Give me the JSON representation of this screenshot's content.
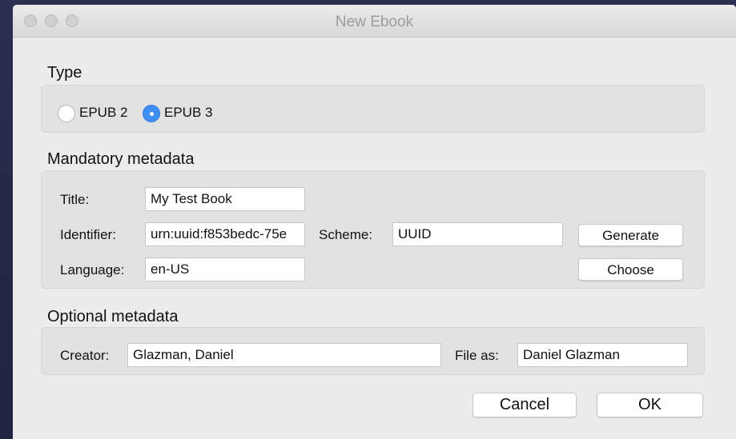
{
  "window": {
    "title": "New Ebook"
  },
  "type_section": {
    "title": "Type",
    "options": [
      {
        "label": "EPUB 2",
        "selected": false
      },
      {
        "label": "EPUB 3",
        "selected": true
      }
    ]
  },
  "mandatory": {
    "title": "Mandatory metadata",
    "title_label": "Title:",
    "title_value": "My Test Book",
    "identifier_label": "Identifier:",
    "identifier_value": "urn:uuid:f853bedc-75e",
    "scheme_label": "Scheme:",
    "scheme_value": "UUID",
    "generate_label": "Generate",
    "language_label": "Language:",
    "language_value": "en-US",
    "choose_label": "Choose"
  },
  "optional": {
    "title": "Optional metadata",
    "creator_label": "Creator:",
    "creator_value": "Glazman, Daniel",
    "file_as_label": "File as:",
    "file_as_value": "Daniel Glazman"
  },
  "buttons": {
    "cancel": "Cancel",
    "ok": "OK"
  },
  "colors": {
    "accent": "#3f8ff4",
    "window_bg": "#ececec",
    "desktop_bg": "#252a46"
  }
}
